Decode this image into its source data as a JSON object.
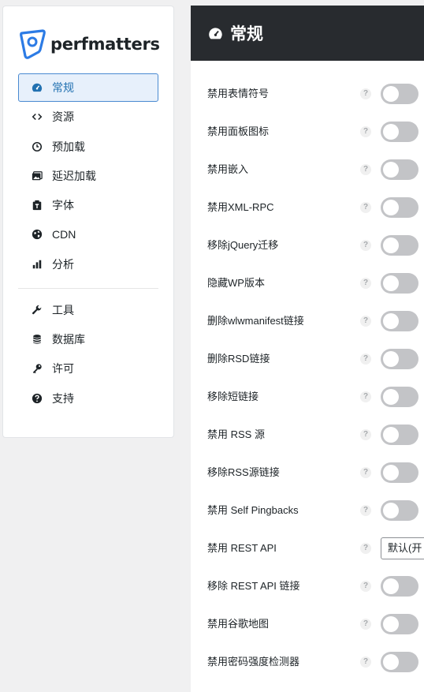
{
  "app": {
    "logo_text": "perfmatters"
  },
  "sidebar": {
    "items": [
      {
        "label": "常规",
        "icon": "dashboard-icon",
        "active": true
      },
      {
        "label": "资源",
        "icon": "code-icon"
      },
      {
        "label": "预加载",
        "icon": "clock-icon"
      },
      {
        "label": "延迟加载",
        "icon": "images-icon"
      },
      {
        "label": "字体",
        "icon": "font-icon"
      },
      {
        "label": "CDN",
        "icon": "globe-icon"
      },
      {
        "label": "分析",
        "icon": "bar-chart-icon"
      }
    ],
    "items2": [
      {
        "label": "工具",
        "icon": "wrench-icon"
      },
      {
        "label": "数据库",
        "icon": "database-icon"
      },
      {
        "label": "许可",
        "icon": "key-icon"
      },
      {
        "label": "支持",
        "icon": "help-icon"
      }
    ]
  },
  "header": {
    "title": "常规",
    "icon": "dashboard-icon"
  },
  "settings": {
    "help_glyph": "?",
    "rows": [
      {
        "label": "禁用表情符号",
        "control": "toggle",
        "enabled": false
      },
      {
        "label": "禁用面板图标",
        "control": "toggle",
        "enabled": false
      },
      {
        "label": "禁用嵌入",
        "control": "toggle",
        "enabled": false
      },
      {
        "label": "禁用XML-RPC",
        "control": "toggle",
        "enabled": false
      },
      {
        "label": "移除jQuery迁移",
        "control": "toggle",
        "enabled": false
      },
      {
        "label": "隐藏WP版本",
        "control": "toggle",
        "enabled": false
      },
      {
        "label": "删除wlwmanifest链接",
        "control": "toggle",
        "enabled": false
      },
      {
        "label": "删除RSD链接",
        "control": "toggle",
        "enabled": false
      },
      {
        "label": "移除短链接",
        "control": "toggle",
        "enabled": false
      },
      {
        "label": "禁用 RSS 源",
        "control": "toggle",
        "enabled": false
      },
      {
        "label": "移除RSS源链接",
        "control": "toggle",
        "enabled": false
      },
      {
        "label": "禁用 Self Pingbacks",
        "control": "toggle",
        "enabled": false
      },
      {
        "label": "禁用 REST API",
        "control": "select",
        "value": "默认(开"
      },
      {
        "label": "移除 REST API 链接",
        "control": "toggle",
        "enabled": false
      },
      {
        "label": "禁用谷歌地图",
        "control": "toggle",
        "enabled": false
      },
      {
        "label": "禁用密码强度检测器",
        "control": "toggle",
        "enabled": false
      }
    ]
  },
  "colors": {
    "accent": "#2271b1",
    "header_bg": "#282b2f",
    "toggle_off": "#c3c4c7"
  }
}
